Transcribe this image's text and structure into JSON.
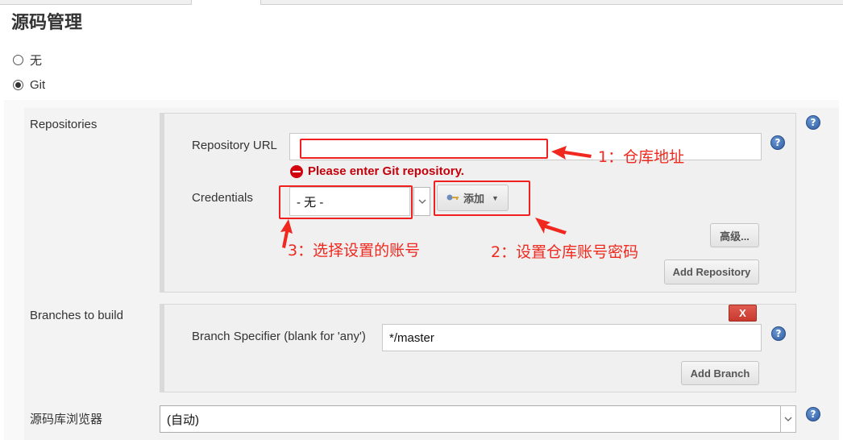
{
  "section": {
    "title": "源码管理"
  },
  "scm_options": [
    {
      "label": "无",
      "checked": false
    },
    {
      "label": "Git",
      "checked": true
    }
  ],
  "repositories": {
    "label": "Repositories",
    "url_label": "Repository URL",
    "url_value": "",
    "error": "Please enter Git repository.",
    "credentials_label": "Credentials",
    "credentials_value": "- 无 -",
    "add_button": "添加",
    "advanced_button": "高级...",
    "add_repo_button": "Add Repository"
  },
  "branches": {
    "label": "Branches to build",
    "delete_button": "X",
    "specifier_label": "Branch Specifier (blank for 'any')",
    "specifier_value": "*/master",
    "add_branch_button": "Add Branch"
  },
  "browser": {
    "label": "源码库浏览器",
    "value": "(自动)"
  },
  "help_icon_glyph": "?",
  "annotations": {
    "a1": "1：仓库地址",
    "a2": "2：设置仓库账号密码",
    "a3": "3：选择设置的账号"
  },
  "colors": {
    "annotation_red": "#f0281e",
    "error_red": "#c4000a",
    "help_blue": "#2c5aa0",
    "delete_red": "#d0453a"
  }
}
